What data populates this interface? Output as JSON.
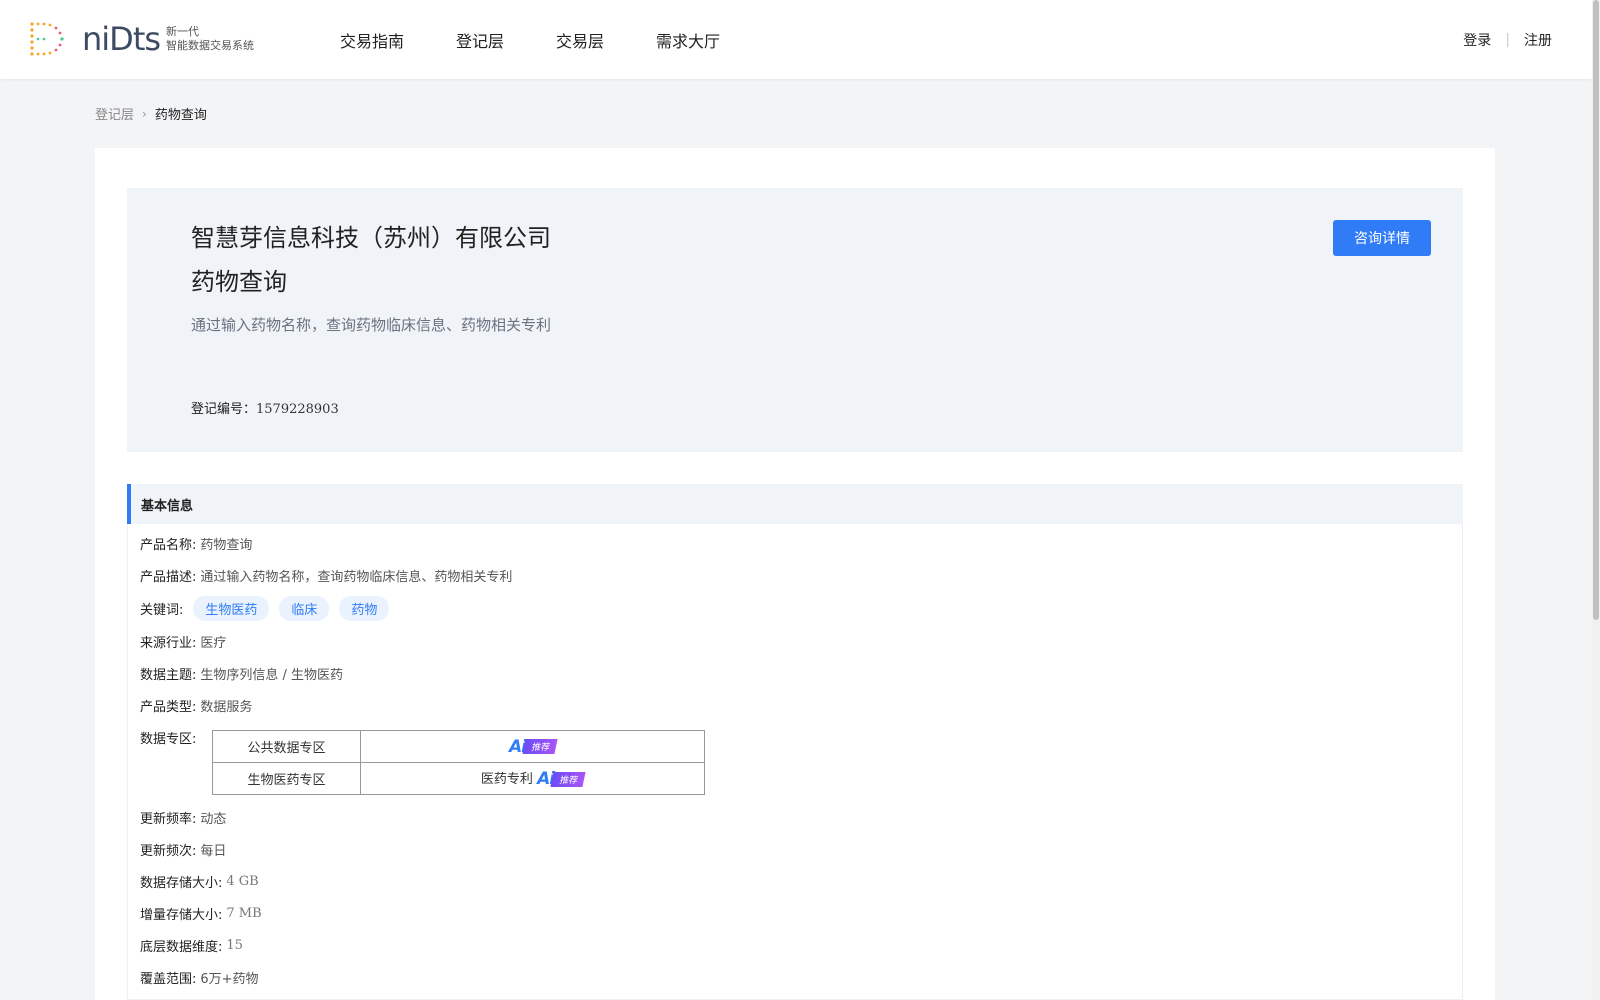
{
  "header": {
    "logo_word": "niDts",
    "logo_tag_line1": "新一代",
    "logo_tag_line2": "智能数据交易系统",
    "nav": [
      "交易指南",
      "登记层",
      "交易层",
      "需求大厅"
    ],
    "login": "登录",
    "register": "注册"
  },
  "breadcrumb": {
    "parent": "登记层",
    "current": "药物查询"
  },
  "hero": {
    "company": "智慧芽信息科技（苏州）有限公司",
    "title": "药物查询",
    "description": "通过输入药物名称，查询药物临床信息、药物相关专利",
    "reg_label": "登记编号：",
    "reg_number": "1579228903",
    "consult_button": "咨询详情"
  },
  "basic_info": {
    "section_title": "基本信息",
    "product_name_label": "产品名称:",
    "product_name": "药物查询",
    "product_desc_label": "产品描述:",
    "product_desc": "通过输入药物名称，查询药物临床信息、药物相关专利",
    "keywords_label": "关键词:",
    "keywords": [
      "生物医药",
      "临床",
      "药物"
    ],
    "industry_label": "来源行业:",
    "industry": "医疗",
    "topic_label": "数据主题:",
    "topic": "生物序列信息 / 生物医药",
    "type_label": "产品类型:",
    "type": "数据服务",
    "zone_label": "数据专区:",
    "zones": [
      {
        "name": "公共数据专区",
        "value": "",
        "badge_ai": "Ai",
        "badge_text": "推荐"
      },
      {
        "name": "生物医药专区",
        "value": "医药专利",
        "badge_ai": "Ai",
        "badge_text": "推荐"
      }
    ],
    "update_rate_label": "更新频率:",
    "update_rate": "动态",
    "update_freq_label": "更新频次:",
    "update_freq": "每日",
    "storage_label": "数据存储大小:",
    "storage": "4 GB",
    "incr_label": "增量存储大小:",
    "incr": "7 MB",
    "dims_label": "底层数据维度:",
    "dims": "15",
    "coverage_label": "覆盖范围:",
    "coverage": "6万+药物"
  },
  "colors": {
    "accent": "#2f7cf6",
    "hero_bg": "#f0f3f7",
    "page_bg": "#f3f4f6"
  }
}
